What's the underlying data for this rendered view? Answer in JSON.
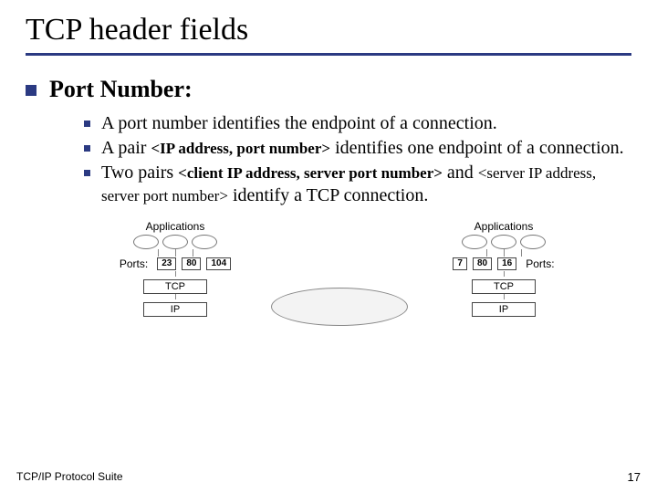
{
  "title": "TCP header fields",
  "section": {
    "heading": "Port Number:"
  },
  "bullets": [
    {
      "text": "A port number identifies the endpoint of a connection."
    },
    {
      "pre": "A pair  ",
      "code": "<IP address, port number>",
      "post": " identifies one endpoint of a connection."
    },
    {
      "pre": "Two pairs ",
      "code1": "<client IP address, server port number>",
      "mid": " and ",
      "code2": "<server IP address, server port number>",
      "post": " identify a TCP connection."
    }
  ],
  "diagram": {
    "apps_label": "Applications",
    "ports_label": "Ports:",
    "tcp_label": "TCP",
    "ip_label": "IP",
    "left_ports": [
      "23",
      "80",
      "104"
    ],
    "right_ports": [
      "7",
      "80",
      "16"
    ]
  },
  "footer": {
    "left": "TCP/IP Protocol Suite",
    "page": "17"
  }
}
